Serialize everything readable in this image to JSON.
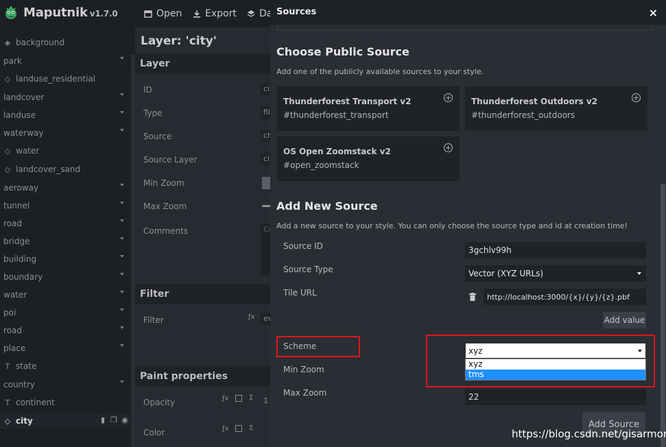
{
  "app": {
    "name": "Maputnik",
    "version": "v1.7.0"
  },
  "toolbar": {
    "open": "Open",
    "export": "Export",
    "data": "Da"
  },
  "layers": [
    {
      "label": "background",
      "icon": "background-icon",
      "expandable": false
    },
    {
      "label": "park",
      "icon": "",
      "expandable": true
    },
    {
      "label": "landuse_residential",
      "icon": "fill-icon",
      "expandable": false
    },
    {
      "label": "landcover",
      "icon": "",
      "expandable": true
    },
    {
      "label": "landuse",
      "icon": "",
      "expandable": true
    },
    {
      "label": "waterway",
      "icon": "",
      "expandable": true
    },
    {
      "label": "water",
      "icon": "fill-icon",
      "expandable": false
    },
    {
      "label": "landcover_sand",
      "icon": "fill-icon",
      "expandable": false
    },
    {
      "label": "aeroway",
      "icon": "",
      "expandable": true
    },
    {
      "label": "tunnel",
      "icon": "",
      "expandable": true
    },
    {
      "label": "road",
      "icon": "",
      "expandable": true
    },
    {
      "label": "bridge",
      "icon": "",
      "expandable": true
    },
    {
      "label": "building",
      "icon": "",
      "expandable": true
    },
    {
      "label": "boundary",
      "icon": "",
      "expandable": true
    },
    {
      "label": "water",
      "icon": "",
      "expandable": true
    },
    {
      "label": "poi",
      "icon": "",
      "expandable": true
    },
    {
      "label": "road",
      "icon": "",
      "expandable": true
    },
    {
      "label": "place",
      "icon": "",
      "expandable": true
    },
    {
      "label": "state",
      "icon": "symbol-icon",
      "expandable": false
    },
    {
      "label": "country",
      "icon": "",
      "expandable": true
    },
    {
      "label": "continent",
      "icon": "symbol-icon",
      "expandable": false
    },
    {
      "label": "city",
      "icon": "fill-icon",
      "expandable": false,
      "active": true
    }
  ],
  "editor": {
    "title": "Layer: 'city'",
    "section_layer": "Layer",
    "fields": {
      "id": "ID",
      "type": "Type",
      "source": "Source",
      "source_layer": "Source Layer",
      "min_zoom": "Min Zoom",
      "max_zoom": "Max Zoom",
      "comments": "Comments"
    },
    "values": {
      "id": "ci",
      "type": "fil",
      "source": "ch",
      "source_layer": "ci",
      "comments": "Co"
    },
    "section_filter": "Filter",
    "filter_label": "Filter",
    "filter_value": "ev",
    "section_paint": "Paint properties",
    "opacity_label": "Opacity",
    "opacity_value": "1",
    "color_label": "Color"
  },
  "modal": {
    "title": "Sources",
    "close": "×",
    "public_heading": "Choose Public Source",
    "public_desc": "Add one of the publicly available sources to your style.",
    "public_sources": [
      {
        "title": "Thunderforest Transport v2",
        "id": "#thunderforest_transport"
      },
      {
        "title": "Thunderforest Outdoors v2",
        "id": "#thunderforest_outdoors"
      },
      {
        "title": "OS Open Zoomstack v2",
        "id": "#open_zoomstack"
      }
    ],
    "new_heading": "Add New Source",
    "new_desc": "Add a new source to your style. You can only choose the source type and id at creation time!",
    "labels": {
      "source_id": "Source ID",
      "source_type": "Source Type",
      "tile_url": "Tile URL",
      "scheme": "Scheme",
      "min_zoom": "Min Zoom",
      "max_zoom": "Max Zoom"
    },
    "values": {
      "source_id": "3gchlv99h",
      "source_type": "Vector (XYZ URLs)",
      "tile_url": "http://localhost:3000/{x}/{y}/{z}.pbf",
      "scheme": "xyz",
      "max_zoom": "22"
    },
    "scheme_options": [
      "xyz",
      "tms"
    ],
    "scheme_highlighted": "tms",
    "add_value": "Add value",
    "add_source": "Add Source"
  },
  "watermark": "https://blog.csdn.net/gisarmory",
  "colors": {
    "highlight_box": "#e0141e",
    "dropdown_selected": "#1e90ff",
    "panel_bg": "#2a2e34"
  }
}
